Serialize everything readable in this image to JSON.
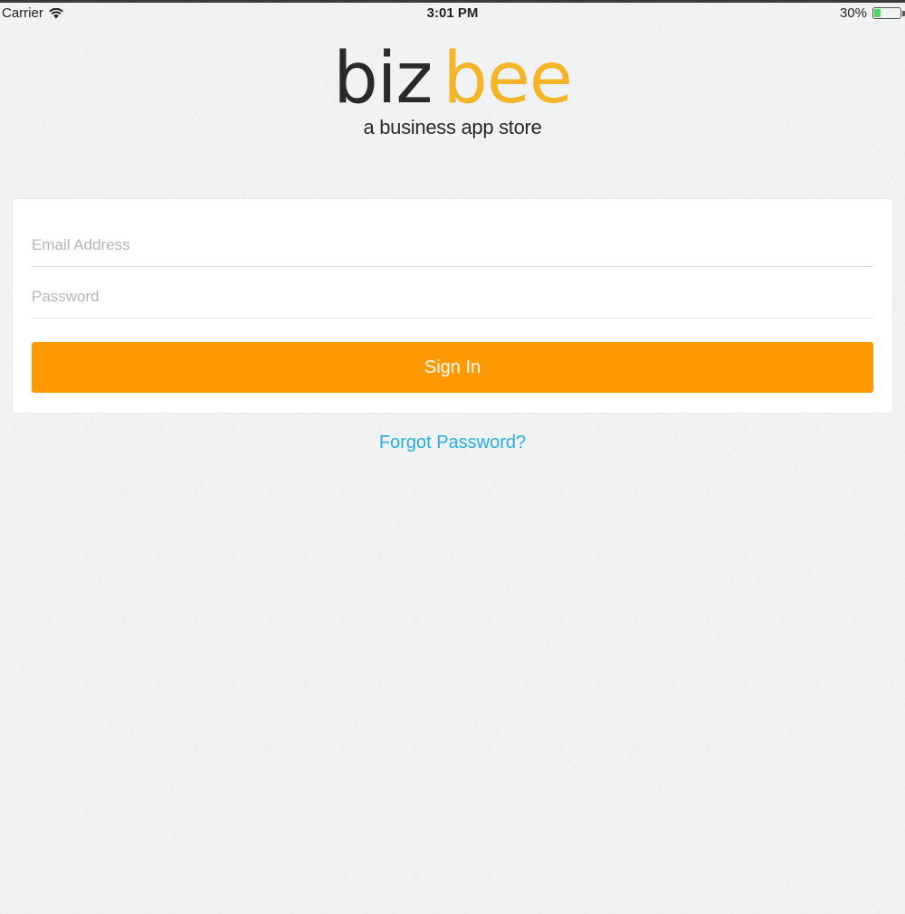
{
  "status_bar": {
    "carrier": "Carrier",
    "time": "3:01 PM",
    "battery_text": "30%",
    "battery_level": 0.3,
    "wifi_icon": "wifi-icon",
    "battery_icon": "battery-icon"
  },
  "logo": {
    "part1": "biz",
    "part2": "bee",
    "tagline": "a business app store",
    "colors": {
      "biz": "#2a2a2a",
      "bee": "#f4b52a"
    }
  },
  "login": {
    "email_placeholder": "Email Address",
    "password_placeholder": "Password",
    "sign_in_label": "Sign In",
    "forgot_label": "Forgot Password?"
  },
  "colors": {
    "accent": "#ff9900",
    "link": "#29aee0",
    "background": "#f1f2f4"
  }
}
